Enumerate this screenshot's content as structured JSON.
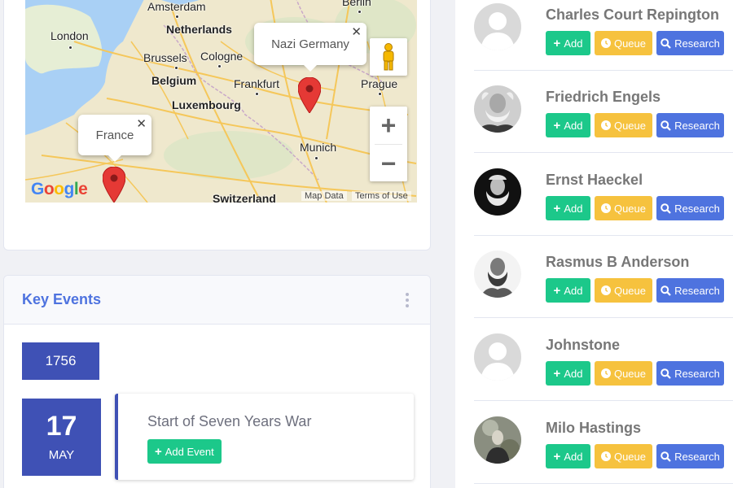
{
  "map": {
    "cities": [
      {
        "name": "Amsterdam",
        "bold": false
      },
      {
        "name": "Berlin",
        "bold": false
      },
      {
        "name": "Netherlands",
        "bold": true
      },
      {
        "name": "London",
        "bold": false
      },
      {
        "name": "Brussels",
        "bold": false
      },
      {
        "name": "Cologne",
        "bold": false
      },
      {
        "name": "Belgium",
        "bold": true
      },
      {
        "name": "Frankfurt",
        "bold": false
      },
      {
        "name": "Prague",
        "bold": false
      },
      {
        "name": "Luxembourg",
        "bold": true
      },
      {
        "name": "Munich",
        "bold": false
      },
      {
        "name": "Switzerland",
        "bold": true
      }
    ],
    "popups": [
      {
        "label": "Nazi Germany",
        "close": "✕"
      },
      {
        "label": "France",
        "close": "✕"
      }
    ],
    "zoom_in": "+",
    "zoom_out": "−",
    "google_logo": "Google",
    "map_data": "Map Data",
    "terms": "Terms of Use",
    "pin_color": "#e53935"
  },
  "events": {
    "title": "Key Events",
    "year": "1756",
    "day": "17",
    "month": "MAY",
    "event_title": "Start of Seven Years War",
    "add_event_label": "Add Event"
  },
  "people": [
    {
      "name": "Charles Court Repington",
      "avatar": "placeholder-avatar",
      "add": "Add",
      "queue": "Queue",
      "research": "Research"
    },
    {
      "name": "Friedrich Engels",
      "avatar": "portrait-photo",
      "add": "Add",
      "queue": "Queue",
      "research": "Research"
    },
    {
      "name": "Ernst Haeckel",
      "avatar": "portrait-photo",
      "add": "Add",
      "queue": "Queue",
      "research": "Research"
    },
    {
      "name": "Rasmus B Anderson",
      "avatar": "portrait-photo",
      "add": "Add",
      "queue": "Queue",
      "research": "Research"
    },
    {
      "name": "Johnstone",
      "avatar": "placeholder-avatar",
      "add": "Add",
      "queue": "Queue",
      "research": "Research"
    },
    {
      "name": "Milo Hastings",
      "avatar": "portrait-photo",
      "add": "Add",
      "queue": "Queue",
      "research": "Research"
    }
  ],
  "colors": {
    "primary": "#4e73df",
    "success": "#1cc88a",
    "warning": "#f6c23e",
    "indigo": "#3f51b5"
  }
}
